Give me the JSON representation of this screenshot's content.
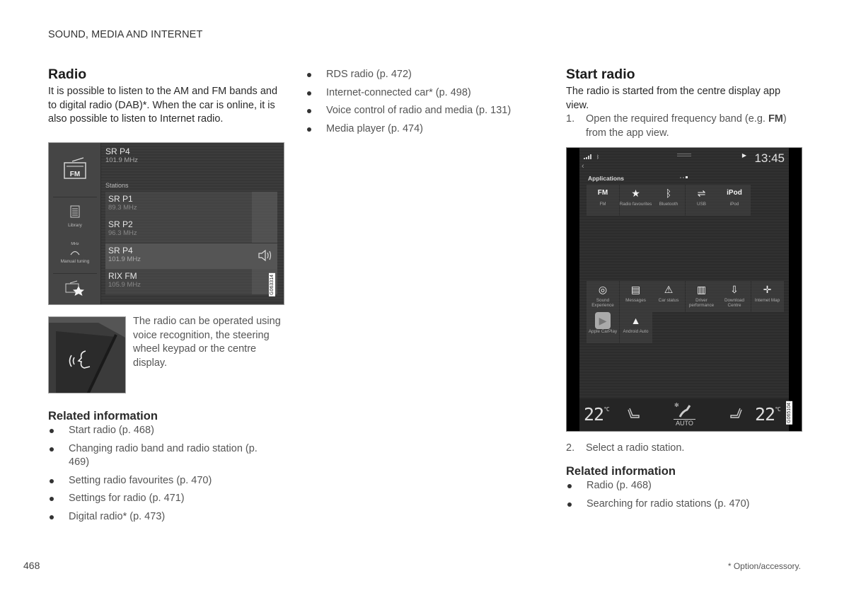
{
  "header": {
    "section": "SOUND, MEDIA AND INTERNET"
  },
  "radio_section": {
    "title": "Radio",
    "intro": "It is possible to listen to the AM and FM bands and to digital radio (DAB)*. When the car is online, it is also possible to listen to Internet radio.",
    "screenshot": {
      "now_playing": {
        "name": "SR P4",
        "freq": "101.9 MHz"
      },
      "stations_label": "Stations",
      "stations": [
        {
          "name": "SR P1",
          "freq": "89.3 MHz",
          "active": false
        },
        {
          "name": "SR P2",
          "freq": "96.3 MHz",
          "active": false
        },
        {
          "name": "SR P4",
          "freq": "101.9 MHz",
          "active": true
        },
        {
          "name": "RIX FM",
          "freq": "105.9 MHz",
          "active": false
        }
      ],
      "sidebar": [
        {
          "icon": "fm-radio-icon",
          "label": "FM"
        },
        {
          "icon": "library-icon",
          "label": "Library"
        },
        {
          "icon": "manual-tuning-icon",
          "label": "Manual tuning",
          "sublabel": "MHz"
        },
        {
          "icon": "radio-favourites-icon",
          "label": ""
        }
      ],
      "ref_code": "G063314"
    },
    "voice_caption": "The radio can be operated using voice recognition, the steering wheel keypad or the centre display.",
    "related_title": "Related information",
    "related": [
      "Start radio (p. 468)",
      "Changing radio band and radio station (p. 469)",
      "Setting radio favourites (p. 470)",
      "Settings for radio (p. 471)",
      "Digital radio* (p. 473)"
    ]
  },
  "column2": {
    "related": [
      "RDS radio (p. 472)",
      "Internet-connected car* (p. 498)",
      "Voice control of radio and media (p. 131)",
      "Media player (p. 474)"
    ]
  },
  "start_radio": {
    "title": "Start radio",
    "intro": "The radio is started from the centre display app view.",
    "step1_num": "1.",
    "step1_pre": "Open the required frequency band (e.g. ",
    "step1_bold": "FM",
    "step1_post": ") from the app view.",
    "step2_num": "2.",
    "step2": "Select a radio station.",
    "screenshot": {
      "clock": "13:45",
      "apps_title": "Applications",
      "apps_row1": [
        {
          "icon": "fm-radio-icon",
          "glyph": "FM",
          "label": "FM"
        },
        {
          "icon": "radio-favourites-icon",
          "glyph": "★",
          "label": "Radio favourites"
        },
        {
          "icon": "bluetooth-icon",
          "glyph": "ᛒ",
          "label": "Bluetooth"
        },
        {
          "icon": "usb-icon",
          "glyph": "⇌",
          "label": "USB"
        },
        {
          "icon": "ipod-icon",
          "glyph": "iPod",
          "label": "iPod"
        }
      ],
      "apps_row2": [
        {
          "icon": "sound-experience-icon",
          "glyph": "◎",
          "label": "Sound Experience"
        },
        {
          "icon": "messages-icon",
          "glyph": "▤",
          "label": "Messages"
        },
        {
          "icon": "car-status-icon",
          "glyph": "⚠",
          "label": "Car status"
        },
        {
          "icon": "driver-performance-icon",
          "glyph": "▥",
          "label": "Driver performance"
        },
        {
          "icon": "download-centre-icon",
          "glyph": "⇩",
          "label": "Download Centre"
        },
        {
          "icon": "internet-map-icon",
          "glyph": "✛",
          "label": "Internet Map"
        }
      ],
      "apps_row3": [
        {
          "icon": "apple-carplay-icon",
          "glyph": "▶",
          "label": "Apple CarPlay"
        },
        {
          "icon": "android-auto-icon",
          "glyph": "▲",
          "label": "Android Auto"
        }
      ],
      "climate": {
        "left_temp": "22",
        "right_temp": "22",
        "unit": "°C",
        "mode": "AUTO"
      },
      "ref_code": "G065104"
    },
    "related_title": "Related information",
    "related": [
      "Radio (p. 468)",
      "Searching for radio stations (p. 470)"
    ]
  },
  "footer": {
    "page_number": "468",
    "note": "* Option/accessory."
  }
}
